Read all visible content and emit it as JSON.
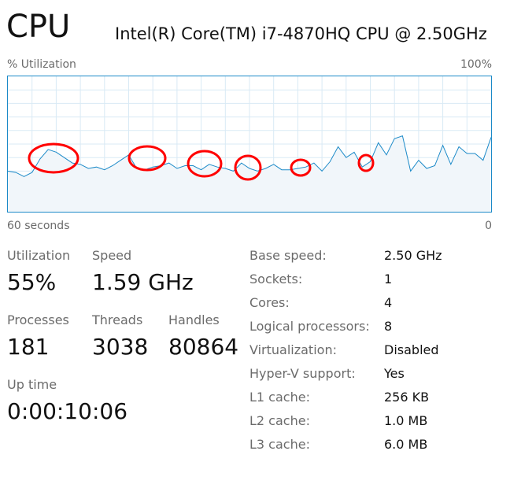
{
  "header": {
    "title": "CPU",
    "cpu_model": "Intel(R) Core(TM) i7-4870HQ CPU @ 2.50GHz"
  },
  "graph": {
    "y_label": "% Utilization",
    "y_max_label": "100%",
    "x_left_label": "60 seconds",
    "x_right_label": "0",
    "line_color": "#1c8ac8",
    "fill_color": "#f1f6fa",
    "grid_color": "#d9eaf5",
    "annotation_color": "#ff0000"
  },
  "chart_data": {
    "type": "area",
    "title": "",
    "xlabel": "",
    "ylabel": "% Utilization",
    "xlim": [
      60,
      0
    ],
    "ylim": [
      0,
      100
    ],
    "x": [
      60,
      59,
      58,
      57,
      56,
      55,
      54,
      53,
      52,
      51,
      50,
      49,
      48,
      47,
      46,
      45,
      44,
      43,
      42,
      41,
      40,
      39,
      38,
      37,
      36,
      35,
      34,
      33,
      32,
      31,
      30,
      29,
      28,
      27,
      26,
      25,
      24,
      23,
      22,
      21,
      20,
      19,
      18,
      17,
      16,
      15,
      14,
      13,
      12,
      11,
      10,
      9,
      8,
      7,
      6,
      5,
      4,
      3,
      2,
      1,
      0
    ],
    "series": [
      {
        "values": [
          30,
          29,
          26,
          29,
          39,
          46,
          44,
          40,
          36,
          35,
          32,
          33,
          31,
          34,
          38,
          42,
          32,
          31,
          33,
          34,
          36,
          32,
          34,
          34,
          31,
          35,
          33,
          32,
          30,
          36,
          32,
          30,
          32,
          35,
          31,
          31,
          32,
          33,
          36,
          30,
          37,
          48,
          40,
          44,
          33,
          37,
          51,
          42,
          54,
          56,
          30,
          38,
          32,
          34,
          49,
          35,
          48,
          43,
          43,
          38,
          55
        ]
      }
    ]
  },
  "stats": {
    "utilization_label": "Utilization",
    "utilization_value": "55%",
    "speed_label": "Speed",
    "speed_value": "1.59 GHz",
    "processes_label": "Processes",
    "processes_value": "181",
    "threads_label": "Threads",
    "threads_value": "3038",
    "handles_label": "Handles",
    "handles_value": "80864",
    "uptime_label": "Up time",
    "uptime_value": "0:00:10:06"
  },
  "details": [
    {
      "label": "Base speed:",
      "value": "2.50 GHz"
    },
    {
      "label": "Sockets:",
      "value": "1"
    },
    {
      "label": "Cores:",
      "value": "4"
    },
    {
      "label": "Logical processors:",
      "value": "8"
    },
    {
      "label": "Virtualization:",
      "value": "Disabled"
    },
    {
      "label": "Hyper-V support:",
      "value": "Yes"
    },
    {
      "label": "L1 cache:",
      "value": "256 KB"
    },
    {
      "label": "L2 cache:",
      "value": "1.0 MB"
    },
    {
      "label": "L3 cache:",
      "value": "6.0 MB"
    }
  ]
}
